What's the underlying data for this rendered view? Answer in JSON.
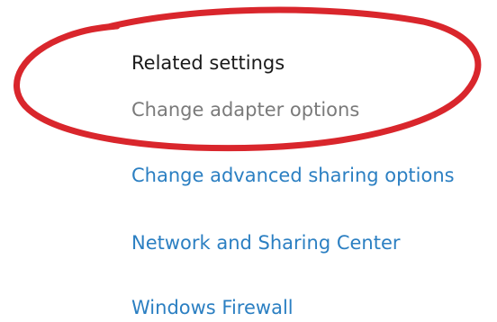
{
  "related_settings": {
    "heading": "Related settings",
    "links": [
      "Change adapter options",
      "Change advanced sharing options",
      "Network and Sharing Center",
      "Windows Firewall"
    ]
  },
  "colors": {
    "heading": "#1a1a1a",
    "highlighted_link": "#7a7a7a",
    "link": "#2b7fc2",
    "annotation": "#d9262c"
  }
}
